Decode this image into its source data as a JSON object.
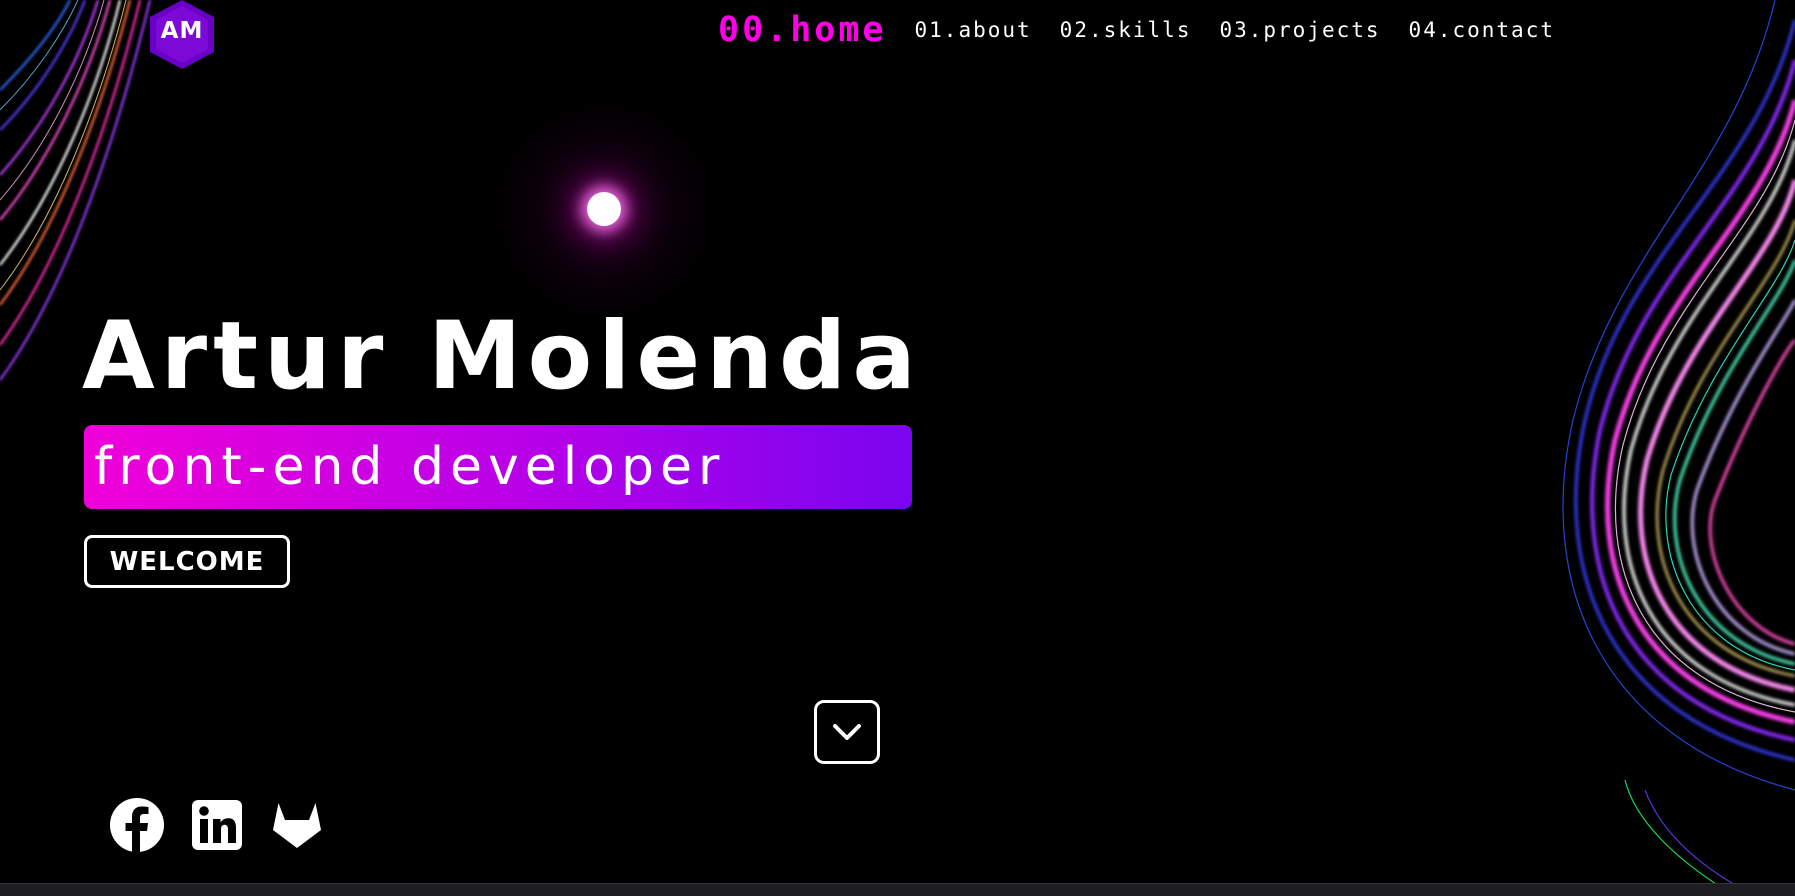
{
  "logo": {
    "text": "AM",
    "color": "#6a00c8"
  },
  "nav": {
    "items": [
      {
        "label": "00.home",
        "active": true
      },
      {
        "label": "01.about"
      },
      {
        "label": "02.skills"
      },
      {
        "label": "03.projects"
      },
      {
        "label": "04.contact"
      }
    ],
    "active_color": "#ff00e6"
  },
  "hero": {
    "name": "Artur Molenda",
    "role": "front-end developer",
    "welcome_label": "WELCOME"
  },
  "icons": {
    "scroll": "chevron-down-icon",
    "social": [
      "facebook-icon",
      "linkedin-icon",
      "gitlab-icon"
    ]
  },
  "colors": {
    "background": "#000000",
    "gradient_start": "#f000d8",
    "gradient_end": "#7a05ef"
  }
}
